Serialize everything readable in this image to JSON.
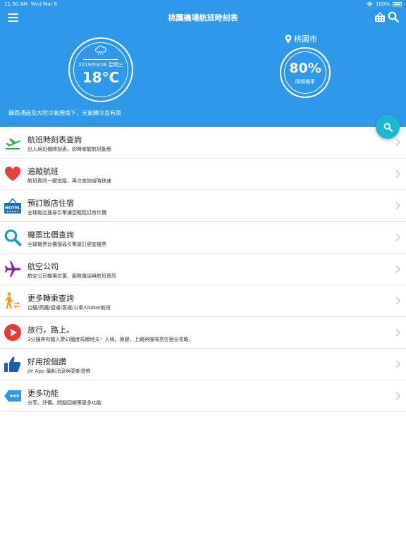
{
  "status_bar": {
    "time": "11:30 AM",
    "date": "Wed Mar 6",
    "battery": "100%"
  },
  "header": {
    "title": "桃園機場航班時刻表"
  },
  "weather": {
    "date": "2019/03/06 星期三",
    "temperature": "18°C",
    "city": "桃園市",
    "rain_percent": "80%",
    "rain_label": "降雨機率",
    "forecast": "鋒面通過及大陸冷氣團南下，天氣轉冷且有雨"
  },
  "colors": {
    "header_bg": "#2f98ea",
    "fab": "#1ab9cf"
  },
  "menu": [
    {
      "title": "航班時刻表查詢",
      "subtitle": "出入境班機時刻表，即時掌握航班動態",
      "icon": "plane-departure-icon"
    },
    {
      "title": "追蹤航班",
      "subtitle": "航班資訊一鍵追蹤，再次查詢省時快速",
      "icon": "heart-icon"
    },
    {
      "title": "預訂飯店住宿",
      "subtitle": "全球飯店搜尋引擎讓您輕鬆訂房比價",
      "icon": "hotel-icon"
    },
    {
      "title": "機票比價查詢",
      "subtitle": "全球機票比價搜尋引擎搶訂便宜機票",
      "icon": "magnifier-icon"
    },
    {
      "title": "航空公司",
      "subtitle": "航空公司機場位置、服務電話與航班資訊",
      "icon": "airplane-icon"
    },
    {
      "title": "更多轉乘查詢",
      "subtitle": "台鐵/高鐵/捷運/客運/公車/Ubike/航班",
      "icon": "transfer-icon"
    },
    {
      "title": "旅行，路上。",
      "subtitle": "3分鐘帶你踏入夢幻國度馬爾地夫！入境、換鏈、上網與機場島住宿全攻略。",
      "icon": "play-icon"
    },
    {
      "title": "好用按個讚",
      "subtitle": "Jie App 最新消息與更新發佈",
      "icon": "thumbs-up-icon"
    },
    {
      "title": "更多功能",
      "subtitle": "分享。評價。問題回報等更多功能",
      "icon": "more-tag-icon"
    }
  ]
}
